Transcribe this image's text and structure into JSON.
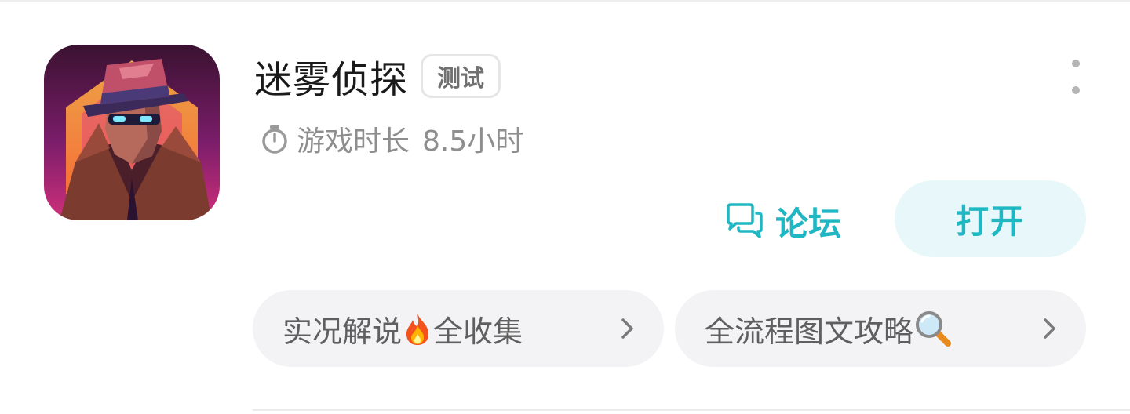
{
  "app": {
    "title": "迷雾侦探",
    "tag": "测试",
    "playtime_label": "游戏时长",
    "playtime_value": "8.5小时",
    "icon_name": "detective-game-icon"
  },
  "actions": {
    "forum_label": "论坛",
    "open_label": "打开",
    "more_icon": "more-vertical-icon"
  },
  "guides": [
    {
      "label": "实况解说",
      "emoji": "fire-emoji",
      "suffix": "全收集"
    },
    {
      "label": "全流程图文攻略",
      "emoji": "magnifier-emoji"
    }
  ],
  "colors": {
    "accent": "#1fb7c3",
    "accent_bg": "#e8f8fa",
    "chip_bg": "#f3f3f5",
    "title": "#1a1a1a",
    "muted": "#8e8e8e"
  }
}
